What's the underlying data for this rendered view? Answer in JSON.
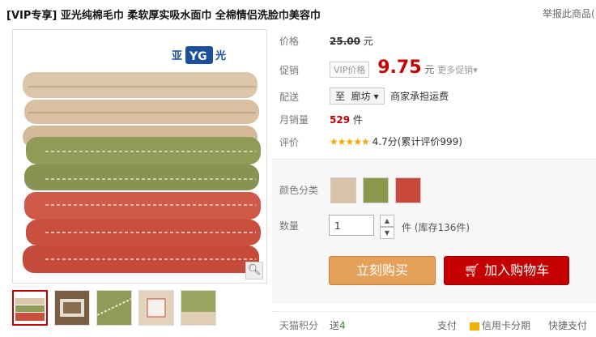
{
  "product": {
    "title": "[VIP专享] 亚光纯棉毛巾 柔软厚实吸水面巾 全棉情侣洗脸巾美容巾",
    "report_link": "举报此商品("
  },
  "price": {
    "label": "价格",
    "original": "25.00",
    "unit": "元"
  },
  "promo": {
    "label": "促销",
    "badge": "VIP价格",
    "price": "9.75",
    "unit": "元",
    "more": "更多促销"
  },
  "shipping": {
    "label": "配送",
    "to": "至",
    "city": "廊坊",
    "note": "商家承担运费"
  },
  "sales": {
    "label": "月销量",
    "count": "529",
    "unit": "件"
  },
  "rating": {
    "label": "评价",
    "stars": "★★★★★",
    "score_text": "4.7分(累计评价999)"
  },
  "options": {
    "color_label": "颜色分类",
    "colors": [
      "#d9c2a9",
      "#8a9a4a",
      "#c8473a"
    ]
  },
  "quantity": {
    "label": "数量",
    "value": "1",
    "unit": "件",
    "stock": "(库存136件)"
  },
  "actions": {
    "buy_now": "立刻购买",
    "add_cart": "加入购物车"
  },
  "footer": {
    "points_label": "天猫积分",
    "points_send": "送",
    "points_value": "4",
    "pay_label": "支付",
    "card": "信用卡分期",
    "quick": "快捷支付"
  },
  "brand": {
    "logo_left": "亚",
    "logo_right": "光"
  }
}
